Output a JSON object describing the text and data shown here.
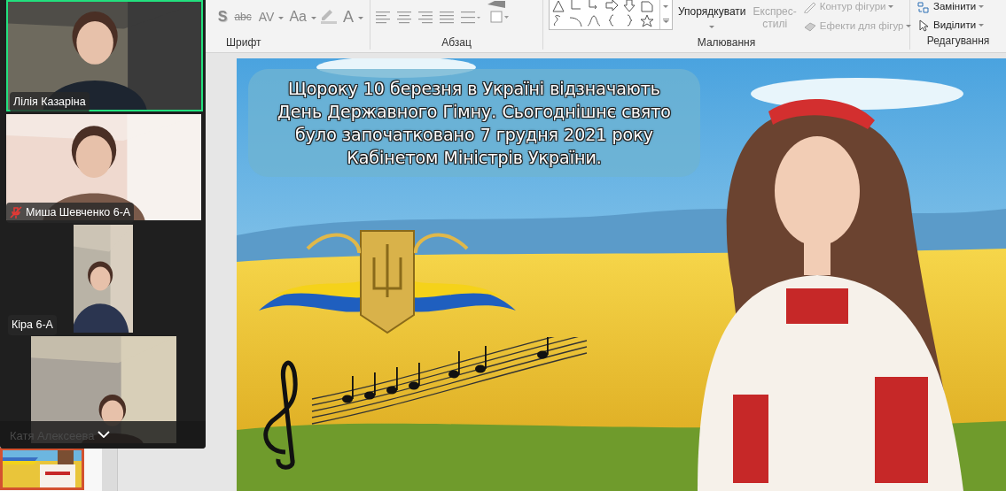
{
  "ribbon": {
    "font_group": {
      "label": "Шрифт",
      "buttons": [
        {
          "text": "S",
          "kind": "shadow"
        },
        {
          "text": "abc",
          "kind": "strike"
        },
        {
          "text": "AV",
          "kind": "spacing"
        },
        {
          "text": "Aa",
          "kind": "case"
        },
        {
          "text": "A",
          "kind": "color"
        }
      ]
    },
    "paragraph_group": {
      "label": "Абзац"
    },
    "drawing_group": {
      "label": "Малювання",
      "arrange": {
        "label": "Упорядкувати",
        "disabled": false
      },
      "quick_styles": {
        "lines": [
          "Експрес-",
          "стилі"
        ],
        "disabled": true
      },
      "shape_options": [
        {
          "label": "Контур фігури",
          "disabled": true
        },
        {
          "label": "Ефекти для фігур",
          "disabled": true
        }
      ]
    },
    "editing_group": {
      "label": "Редагування",
      "buttons": [
        {
          "label": "Замінити",
          "kind": "replace"
        },
        {
          "label": "Виділити",
          "kind": "select"
        }
      ]
    }
  },
  "thumbnails": [
    {
      "selected": true
    }
  ],
  "participants": [
    {
      "name": "Лілія Казаріна",
      "speaking": true,
      "muted": false
    },
    {
      "name": "Миша Шевченко 6-А",
      "speaking": false,
      "muted": true
    },
    {
      "name": "Кіра 6-А",
      "speaking": false,
      "muted": false
    },
    {
      "name": "Катя Алексеева",
      "speaking": false,
      "muted": false
    }
  ],
  "slide": {
    "text": "Щороку 10 березня в Україні відзначають\nДень Державного Гімну. Сьогоднішнє свято\nбуло започатковано 7 грудня 2021 року\nКабінетом Міністрів України."
  }
}
